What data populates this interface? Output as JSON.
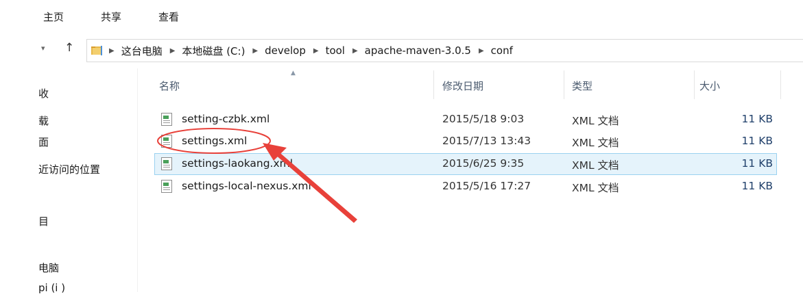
{
  "ribbon": {
    "tabs": [
      "主页",
      "共享",
      "查看"
    ]
  },
  "nav": {
    "down_icon": "▾",
    "up_icon": "↑",
    "path": [
      "这台电脑",
      "本地磁盘 (C:)",
      "develop",
      "tool",
      "apache-maven-3.0.5",
      "conf"
    ]
  },
  "sidebar": {
    "items": [
      "收",
      "载",
      "面",
      "近访问的位置",
      "目",
      "电脑",
      "pi (i  )"
    ]
  },
  "columns": {
    "name": "名称",
    "date": "修改日期",
    "type": "类型",
    "size": "大小"
  },
  "files": [
    {
      "name": "setting-czbk.xml",
      "date": "2015/5/18 9:03",
      "type": "XML 文档",
      "size": "11 KB"
    },
    {
      "name": "settings.xml",
      "date": "2015/7/13 13:43",
      "type": "XML 文档",
      "size": "11 KB"
    },
    {
      "name": "settings-laokang.xml",
      "date": "2015/6/25 9:35",
      "type": "XML 文档",
      "size": "11 KB"
    },
    {
      "name": "settings-local-nexus.xml",
      "date": "2015/5/16 17:27",
      "type": "XML 文档",
      "size": "11 KB"
    }
  ],
  "colors": {
    "selection_bg": "#e5f3fb",
    "selection_border": "#99d1f0",
    "annotation": "#e8413a"
  }
}
